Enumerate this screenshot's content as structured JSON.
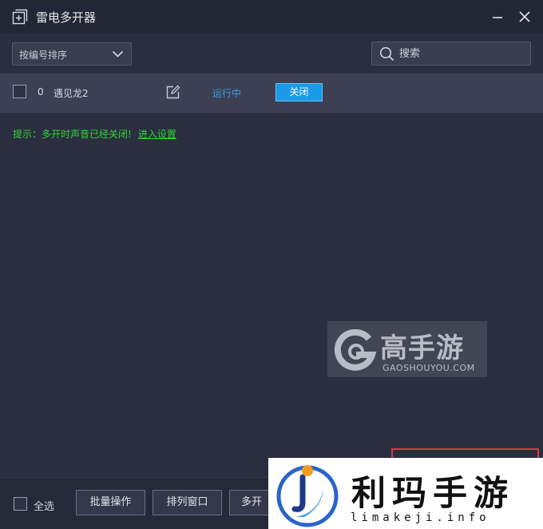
{
  "window": {
    "title": "雷电多开器",
    "icon": "window-add-icon"
  },
  "toolbar": {
    "sort_label": "按编号排序",
    "search_placeholder": "搜索"
  },
  "rows": [
    {
      "index": "0",
      "name": "遇见龙2",
      "status": "运行中",
      "action_label": "关闭"
    }
  ],
  "notice": {
    "text": "提示：多开时声音已经关闭!",
    "link_text": "进入设置"
  },
  "footer": {
    "select_all_label": "全选",
    "batch_label": "批量操作",
    "arrange_label": "排列窗口",
    "more_label": "多开"
  },
  "watermark": {
    "name_cn": "高手游",
    "domain": "GAOSHOUYOU.COM"
  },
  "brand_overlay": {
    "name_cn": "利玛手游",
    "domain": "limakeji.info"
  },
  "colors": {
    "background": "#2b2e3e",
    "titlebar": "#232634",
    "row_background": "#3c4052",
    "accent_blue": "#1a9ae8",
    "status_blue": "#3a9be0",
    "notice_green": "#2fd43a",
    "highlight_red": "#d93a4a"
  }
}
